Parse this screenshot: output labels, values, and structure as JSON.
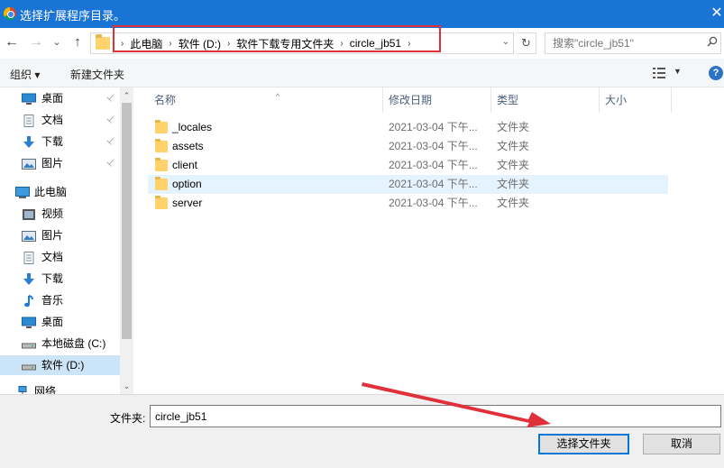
{
  "window": {
    "title": "选择扩展程序目录。",
    "close_glyph": "✕"
  },
  "nav": {
    "back_glyph": "←",
    "forward_glyph": "→",
    "recent_glyph": "⌄",
    "up_glyph": "↑",
    "breadcrumbs": [
      "此电脑",
      "软件 (D:)",
      "软件下载专用文件夹",
      "circle_jb51"
    ],
    "separator": "›",
    "dropdown_glyph": "⌄",
    "refresh_glyph": "↻",
    "search_placeholder": "搜索\"circle_jb51\""
  },
  "toolbar": {
    "organize_label": "组织 ▾",
    "new_folder_label": "新建文件夹",
    "help_glyph": "?"
  },
  "sidebar": {
    "pin_glyph": "📌",
    "items": [
      {
        "label": "桌面",
        "icon": "desktop-icon",
        "pinned": true,
        "indent": "quick"
      },
      {
        "label": "文档",
        "icon": "documents-icon",
        "pinned": true,
        "indent": "quick"
      },
      {
        "label": "下载",
        "icon": "download-icon",
        "pinned": true,
        "indent": "quick"
      },
      {
        "label": "图片",
        "icon": "pictures-icon",
        "pinned": true,
        "indent": "quick"
      },
      {
        "label": "此电脑",
        "icon": "this-pc-icon",
        "pinned": false,
        "indent": "root"
      },
      {
        "label": "视频",
        "icon": "videos-icon",
        "pinned": false,
        "indent": "child"
      },
      {
        "label": "图片",
        "icon": "pictures-icon",
        "pinned": false,
        "indent": "child"
      },
      {
        "label": "文档",
        "icon": "documents-icon",
        "pinned": false,
        "indent": "child"
      },
      {
        "label": "下载",
        "icon": "download-icon",
        "pinned": false,
        "indent": "child"
      },
      {
        "label": "音乐",
        "icon": "music-icon",
        "pinned": false,
        "indent": "child"
      },
      {
        "label": "桌面",
        "icon": "desktop-icon",
        "pinned": false,
        "indent": "child"
      },
      {
        "label": "本地磁盘 (C:)",
        "icon": "drive-icon",
        "pinned": false,
        "indent": "child"
      },
      {
        "label": "软件 (D:)",
        "icon": "drive-icon",
        "pinned": false,
        "indent": "child",
        "selected": true
      },
      {
        "label": "网络",
        "icon": "network-icon",
        "pinned": false,
        "indent": "root"
      }
    ],
    "scroll_up_glyph": "⌃",
    "scroll_down_glyph": "⌄"
  },
  "columns": {
    "name": "名称",
    "date": "修改日期",
    "type": "类型",
    "size": "大小",
    "sort_glyph": "^"
  },
  "files": [
    {
      "name": "_locales",
      "date": "2021-03-04 下午...",
      "type": "文件夹"
    },
    {
      "name": "assets",
      "date": "2021-03-04 下午...",
      "type": "文件夹"
    },
    {
      "name": "client",
      "date": "2021-03-04 下午...",
      "type": "文件夹"
    },
    {
      "name": "option",
      "date": "2021-03-04 下午...",
      "type": "文件夹",
      "selected": true
    },
    {
      "name": "server",
      "date": "2021-03-04 下午...",
      "type": "文件夹"
    }
  ],
  "footer": {
    "filename_label": "文件夹:",
    "filename_value": "circle_jb51",
    "select_button": "选择文件夹",
    "cancel_button": "取消"
  },
  "colors": {
    "titlebar": "#1a74d6",
    "annotation_red": "#e0303a",
    "selection": "#cce4f7",
    "row_selection": "#e5f3ff"
  }
}
